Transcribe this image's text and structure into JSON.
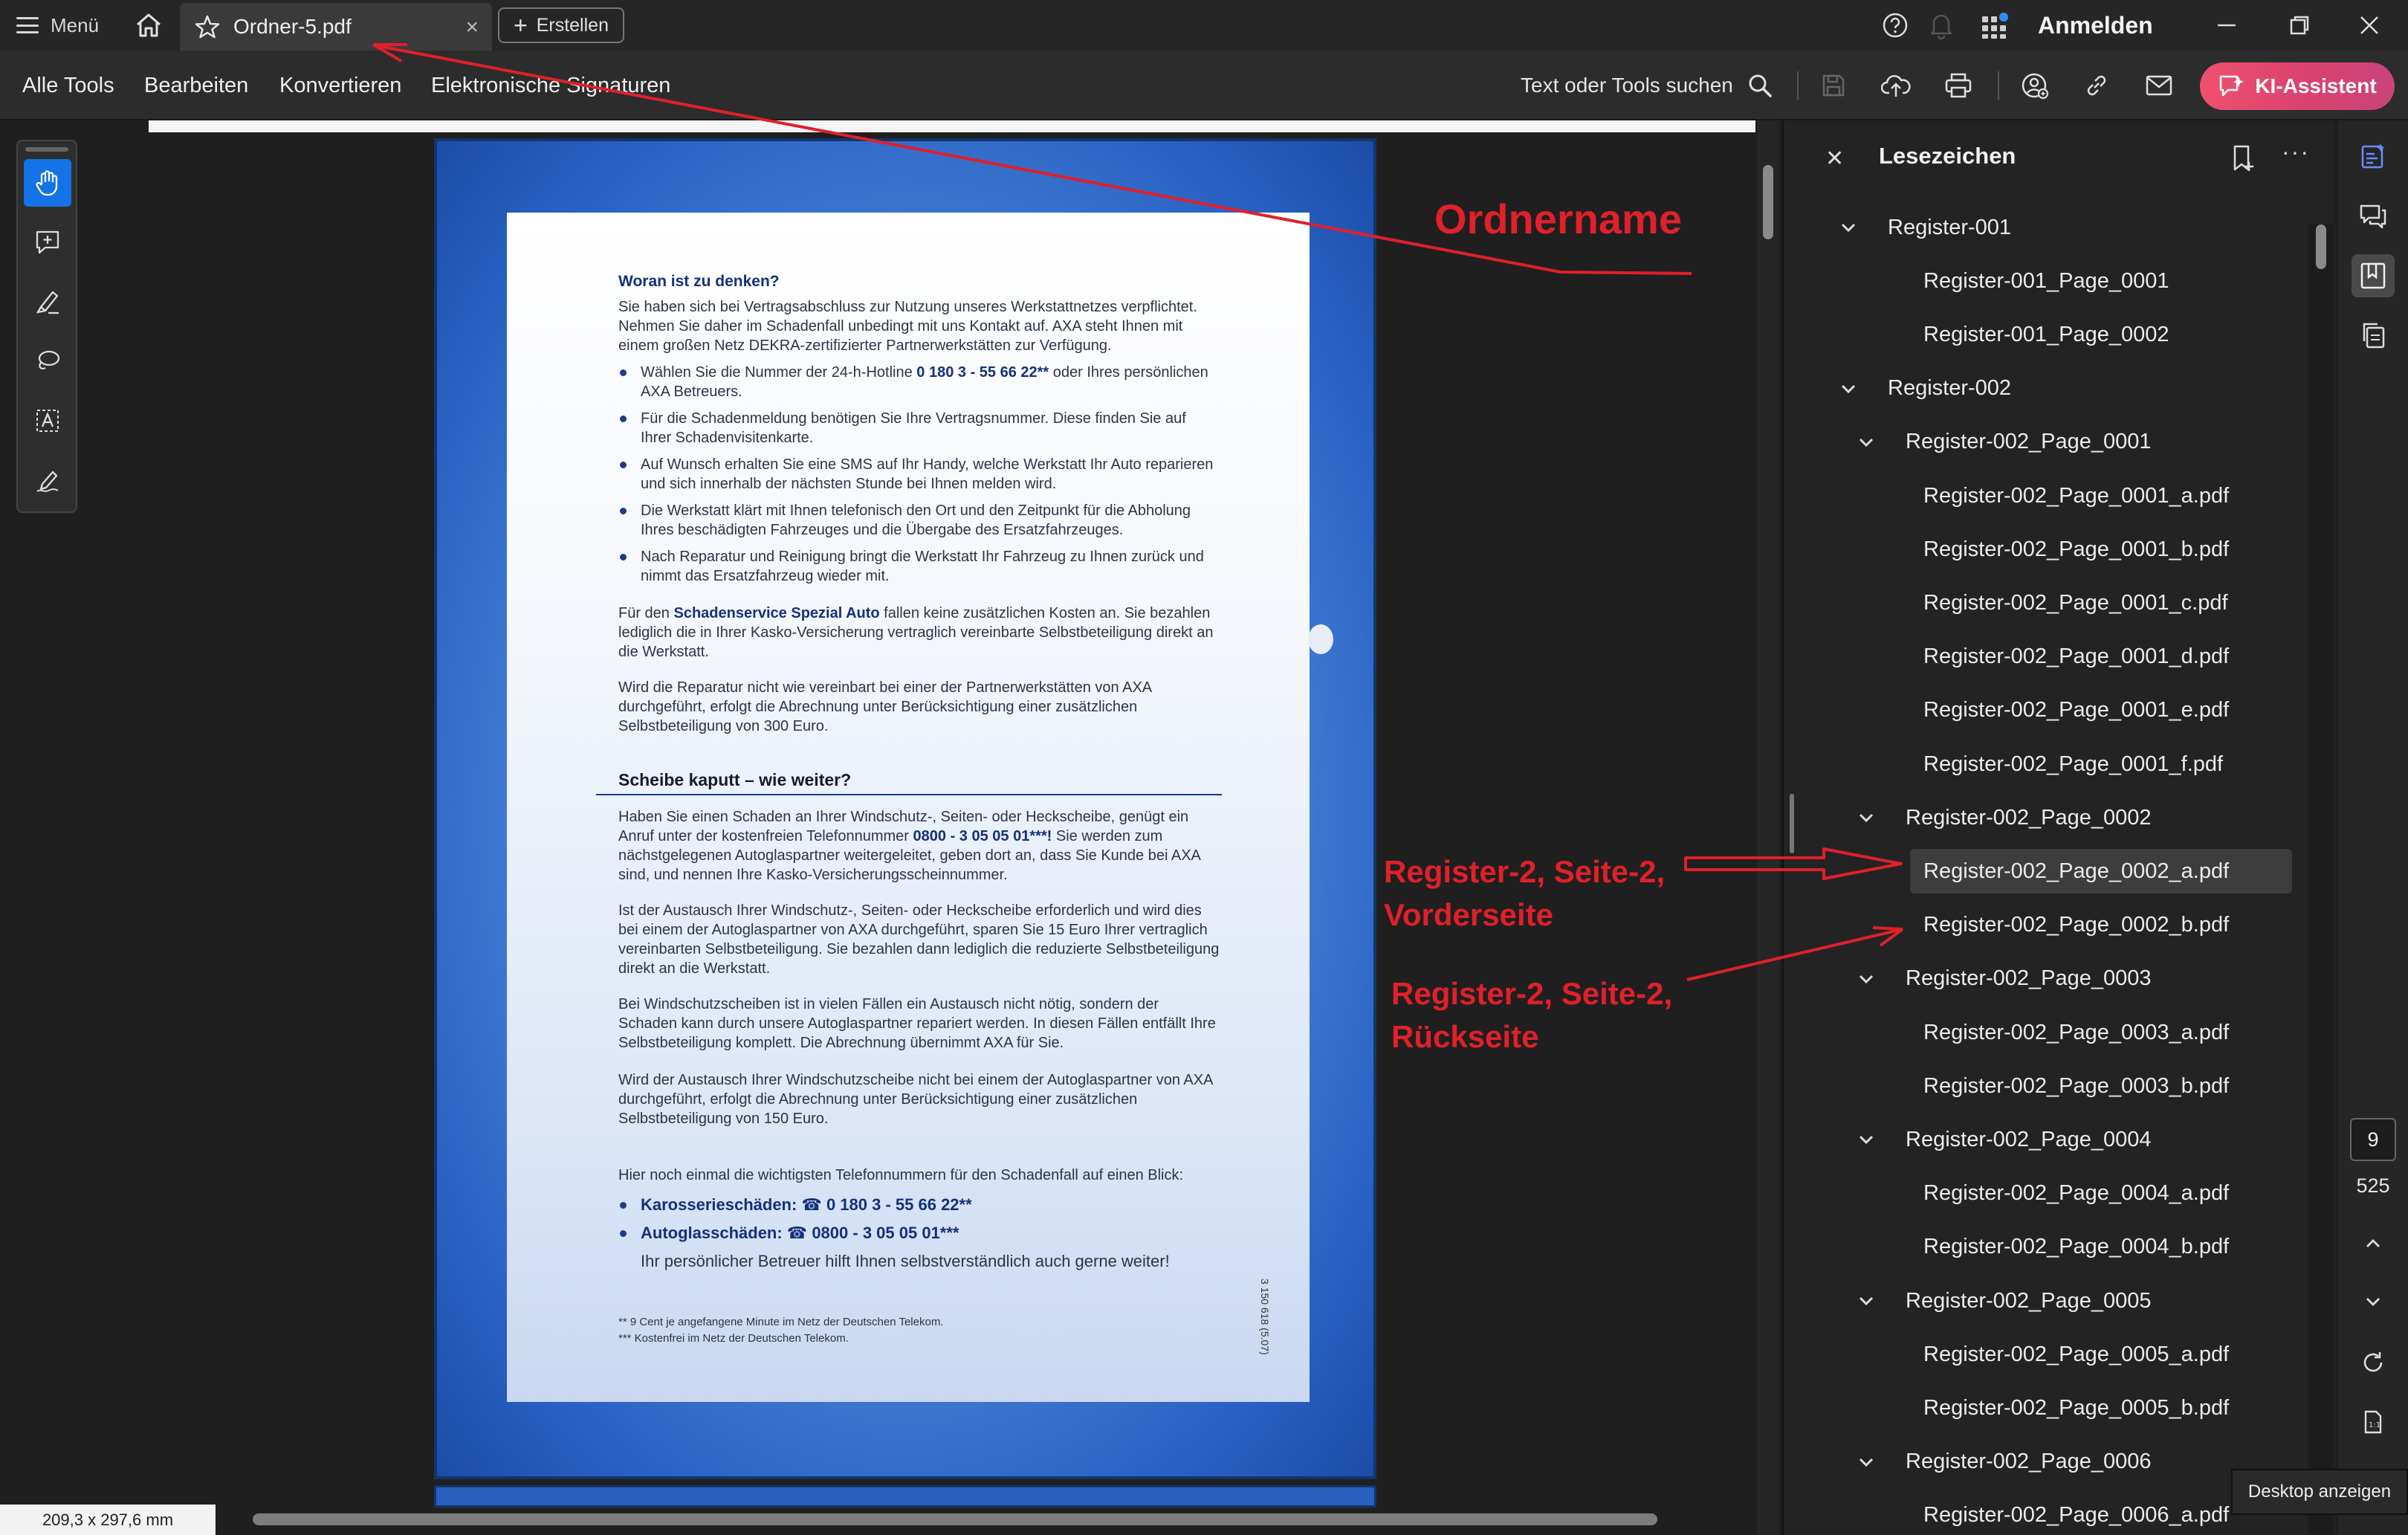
{
  "titlebar": {
    "menu_label": "Menü",
    "tab_label": "Ordner-5.pdf",
    "create_label": "Erstellen",
    "signin_label": "Anmelden"
  },
  "toolbar": {
    "menu": [
      "Alle Tools",
      "Bearbeiten",
      "Konvertieren",
      "Elektronische Signaturen"
    ],
    "search_label": "Text oder Tools suchen",
    "ai_label": "KI-Assistent"
  },
  "document": {
    "s1_title": "Woran ist zu denken?",
    "s1_intro": "Sie haben sich bei Vertragsabschluss zur Nutzung unseres Werkstattnetzes verpflichtet. Nehmen Sie daher im Schadenfall unbedingt mit uns Kontakt auf. AXA steht Ihnen mit einem großen Netz DEKRA-zertifizierter Partnerwerkstätten zur Verfügung.",
    "s1_b1a": "Wählen Sie die Nummer der 24-h-Hotline ",
    "s1_b1num": "0 180 3 - 55 66 22**",
    "s1_b1b": " oder Ihres persönlichen AXA Betreuers.",
    "s1_b2": "Für die Schadenmeldung benötigen Sie Ihre Vertragsnummer. Diese finden Sie auf Ihrer Schadenvisitenkarte.",
    "s1_b3": "Auf Wunsch erhalten Sie eine SMS auf Ihr Handy, welche Werkstatt Ihr Auto reparieren und sich innerhalb der nächsten Stunde bei Ihnen melden wird.",
    "s1_b4": "Die Werkstatt klärt mit Ihnen telefonisch den Ort und den Zeitpunkt für die Abholung Ihres beschädigten Fahrzeuges und die Übergabe des Ersatzfahrzeuges.",
    "s1_b5": "Nach Reparatur und Reinigung bringt die Werkstatt Ihr Fahrzeug zu Ihnen zurück und nimmt das Ersatzfahrzeug wieder mit.",
    "s1_p2a": "Für den ",
    "s1_p2strong": "Schadenservice Spezial Auto",
    "s1_p2b": " fallen keine zusätzlichen Kosten an. Sie bezahlen lediglich die in Ihrer Kasko-Versicherung vertraglich vereinbarte Selbstbeteiligung direkt an die Werkstatt.",
    "s1_p3": "Wird die Reparatur nicht wie vereinbart bei einer der Partnerwerkstätten von AXA durchgeführt, erfolgt die Abrechnung unter Berücksichtigung einer zusätzlichen Selbstbeteiligung von 300 Euro.",
    "s2_title": "Scheibe kaputt – wie weiter?",
    "s2_p1a": "Haben Sie einen Schaden an Ihrer Windschutz-, Seiten- oder Heckscheibe, genügt ein Anruf unter der kostenfreien Telefonnummer ",
    "s2_p1num": "0800 - 3 05 05 01***!",
    "s2_p1b": " Sie werden zum nächstgelegenen Autoglaspartner weitergeleitet, geben dort an, dass Sie Kunde bei AXA sind, und nennen Ihre Kasko-Versicherungsscheinnummer.",
    "s2_p2": "Ist der Austausch Ihrer Windschutz-, Seiten- oder Heckscheibe erforderlich und wird dies bei einem der Autoglaspartner von AXA durchgeführt, sparen Sie 15 Euro Ihrer vertraglich vereinbarten Selbstbeteiligung. Sie bezahlen dann lediglich die reduzierte Selbstbeteiligung direkt an die Werkstatt.",
    "s2_p3": "Bei Windschutzscheiben ist in vielen Fällen ein Austausch nicht nötig, sondern der Schaden kann durch unsere Autoglaspartner repariert werden. In diesen Fällen entfällt Ihre Selbstbeteiligung komplett. Die Abrechnung übernimmt AXA für Sie.",
    "s2_p4": "Wird der Austausch Ihrer Windschutzscheibe nicht bei einem der Autoglaspartner von AXA durchgeführt, erfolgt die Abrechnung unter Berücksichtigung einer zusätzlichen Selbstbeteiligung von 150 Euro.",
    "s3_intro": "Hier noch einmal die wichtigsten Telefonnummern für den Schadenfall auf einen Blick:",
    "s3_b1": "Karosserieschäden: ☎ 0 180 3 - 55 66 22**",
    "s3_b2": "Autoglasschäden: ☎ 0800 - 3 05 05 01***",
    "s3_p": "Ihr persönlicher Betreuer hilft Ihnen selbstverständlich auch gerne weiter!",
    "fn1": "**  9 Cent je angefangene Minute im Netz der Deutschen Telekom.",
    "fn2": "*** Kostenfrei im Netz der Deutschen Telekom.",
    "side_code": "3 150 618 (5.07)"
  },
  "status": {
    "dimensions": "209,3 x 297,6 mm"
  },
  "panel": {
    "title": "Lesezeichen",
    "bookmarks": [
      {
        "label": "Register-001",
        "expanded": true
      },
      {
        "label": "Register-001_Page_0001"
      },
      {
        "label": "Register-001_Page_0002"
      },
      {
        "label": "Register-002",
        "expanded": true
      },
      {
        "label": "Register-002_Page_0001",
        "expanded": true
      },
      {
        "label": "Register-002_Page_0001_a.pdf"
      },
      {
        "label": "Register-002_Page_0001_b.pdf"
      },
      {
        "label": "Register-002_Page_0001_c.pdf"
      },
      {
        "label": "Register-002_Page_0001_d.pdf"
      },
      {
        "label": "Register-002_Page_0001_e.pdf"
      },
      {
        "label": "Register-002_Page_0001_f.pdf"
      },
      {
        "label": "Register-002_Page_0002",
        "expanded": true
      },
      {
        "label": "Register-002_Page_0002_a.pdf",
        "selected": true
      },
      {
        "label": "Register-002_Page_0002_b.pdf"
      },
      {
        "label": "Register-002_Page_0003",
        "expanded": true
      },
      {
        "label": "Register-002_Page_0003_a.pdf"
      },
      {
        "label": "Register-002_Page_0003_b.pdf"
      },
      {
        "label": "Register-002_Page_0004",
        "expanded": true
      },
      {
        "label": "Register-002_Page_0004_a.pdf"
      },
      {
        "label": "Register-002_Page_0004_b.pdf"
      },
      {
        "label": "Register-002_Page_0005",
        "expanded": true
      },
      {
        "label": "Register-002_Page_0005_a.pdf"
      },
      {
        "label": "Register-002_Page_0005_b.pdf"
      },
      {
        "label": "Register-002_Page_0006",
        "expanded": true
      },
      {
        "label": "Register-002_Page_0006_a.pdf"
      }
    ]
  },
  "rail": {
    "current_page": "9",
    "total_pages": "525",
    "tooltip": "Desktop anzeigen"
  },
  "annotations": {
    "folder_name": "Ordnername",
    "front_line1": "Register-2, Seite-2,",
    "front_line2": "Vorderseite",
    "back_line1": "Register-2, Seite-2,",
    "back_line2": "Rückseite"
  },
  "colors": {
    "accent": "#1473e6",
    "ai_button": "#e8496e",
    "annotation": "#e0202a",
    "page_blue": "#2a62c4"
  }
}
